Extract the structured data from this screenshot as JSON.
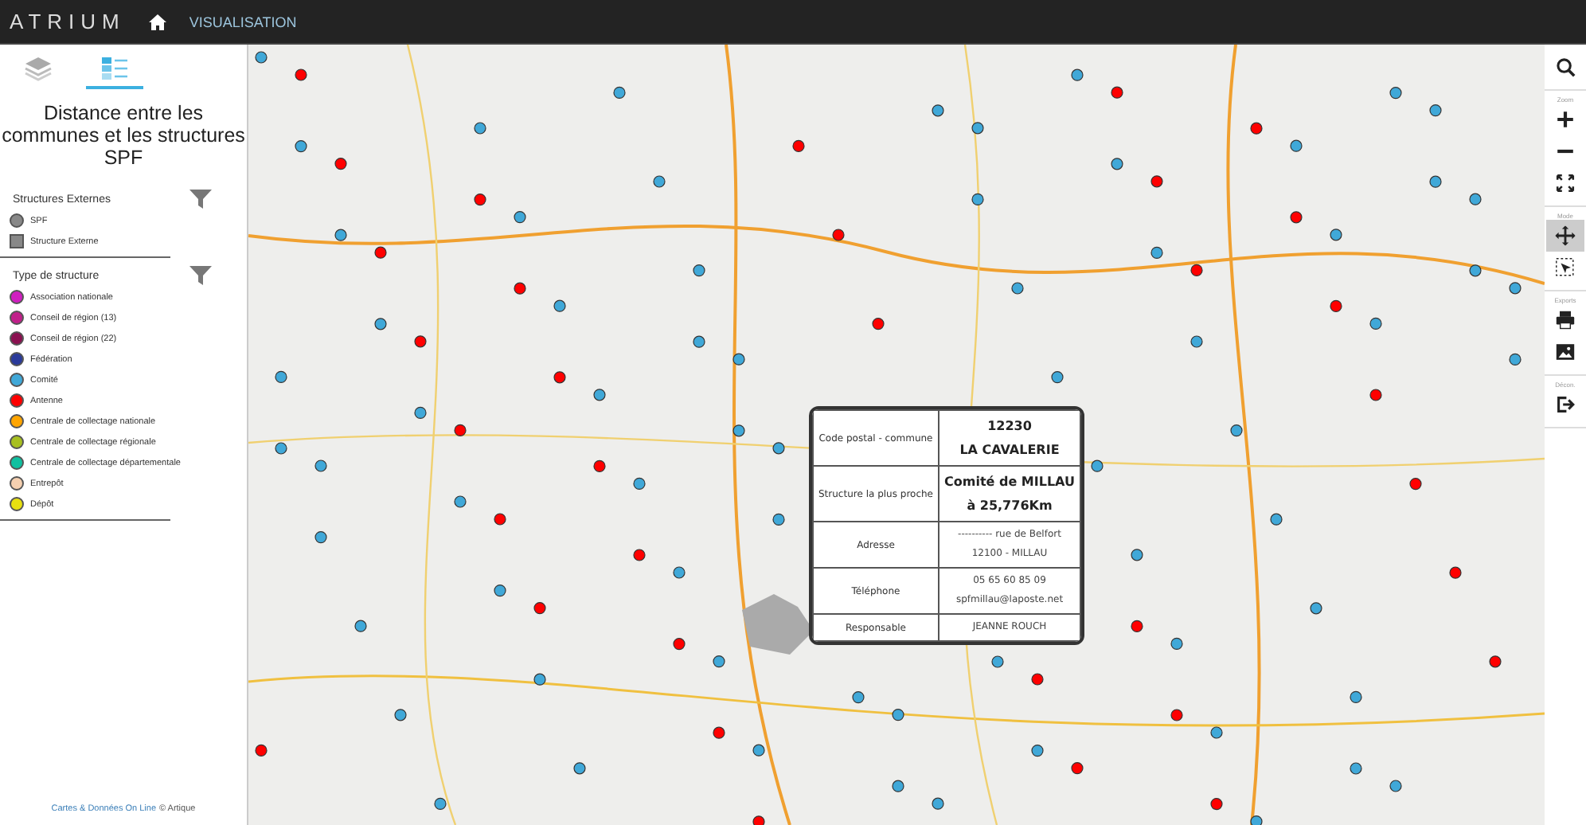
{
  "header": {
    "logo": "ATRIUM",
    "nav": "VISUALISATION"
  },
  "sidebar": {
    "tabs": [
      {
        "kind": "layers",
        "selected": false
      },
      {
        "kind": "legend",
        "selected": true
      }
    ],
    "title": "Distance entre les communes et les structures SPF",
    "legend_sections": [
      {
        "title": "Structures Externes",
        "items": [
          {
            "label": "SPF",
            "kind": "circle",
            "color": "#888888"
          },
          {
            "label": "Structure Externe",
            "kind": "square",
            "color": "#888888"
          }
        ]
      },
      {
        "title": "Type de structure",
        "items": [
          {
            "label": "Association nationale",
            "kind": "circle",
            "color": "#d01fc0"
          },
          {
            "label": "Conseil de région (13)",
            "kind": "circle",
            "color": "#c0208a"
          },
          {
            "label": "Conseil de région (22)",
            "kind": "circle",
            "color": "#8a1050"
          },
          {
            "label": "Fédération",
            "kind": "circle",
            "color": "#2a3a9a"
          },
          {
            "label": "Comité",
            "kind": "circle",
            "color": "#40a8d8"
          },
          {
            "label": "Antenne",
            "kind": "circle",
            "color": "#ff0000"
          },
          {
            "label": "Centrale de collectage nationale",
            "kind": "circle",
            "color": "#ffa500"
          },
          {
            "label": "Centrale de collectage régionale",
            "kind": "circle",
            "color": "#a8c020"
          },
          {
            "label": "Centrale de collectage départementale",
            "kind": "circle",
            "color": "#10c0a0"
          },
          {
            "label": "Entrepôt",
            "kind": "circle",
            "color": "#f5d0b0"
          },
          {
            "label": "Dépôt",
            "kind": "circle",
            "color": "#e8e010"
          }
        ]
      }
    ],
    "footer": {
      "link": "Cartes & Données On Line",
      "credit": "© Artique"
    }
  },
  "popup": {
    "rows": [
      {
        "label": "Code postal - commune",
        "values": [
          "12230",
          "LA CAVALERIE"
        ],
        "emphasis": true
      },
      {
        "label": "Structure la plus proche",
        "values": [
          "Comité de MILLAU",
          "à 25,776Km"
        ],
        "emphasis": true
      },
      {
        "label": "Adresse",
        "values": [
          "---------- rue de Belfort",
          "12100 - MILLAU"
        ],
        "emphasis": false
      },
      {
        "label": "Téléphone",
        "values": [
          "05 65 60 85 09",
          "spfmillau@laposte.net"
        ],
        "emphasis": false
      },
      {
        "label": "Responsable",
        "values": [
          "JEANNE ROUCH"
        ],
        "emphasis": false
      }
    ]
  },
  "toolbar": {
    "groups": [
      {
        "buttons": [
          {
            "kind": "search",
            "selected": false
          }
        ]
      },
      {
        "label": "Zoom",
        "buttons": [
          {
            "kind": "zoomin",
            "selected": false
          },
          {
            "kind": "zoomout",
            "selected": false
          },
          {
            "kind": "extent",
            "selected": false
          }
        ]
      },
      {
        "label": "Mode",
        "buttons": [
          {
            "kind": "pan",
            "selected": true
          },
          {
            "kind": "select",
            "selected": false
          }
        ]
      },
      {
        "label": "Exports",
        "buttons": [
          {
            "kind": "print",
            "selected": false
          },
          {
            "kind": "image",
            "selected": false
          }
        ]
      },
      {
        "label": "Décon.",
        "buttons": [
          {
            "kind": "logout",
            "selected": false
          }
        ]
      }
    ]
  }
}
